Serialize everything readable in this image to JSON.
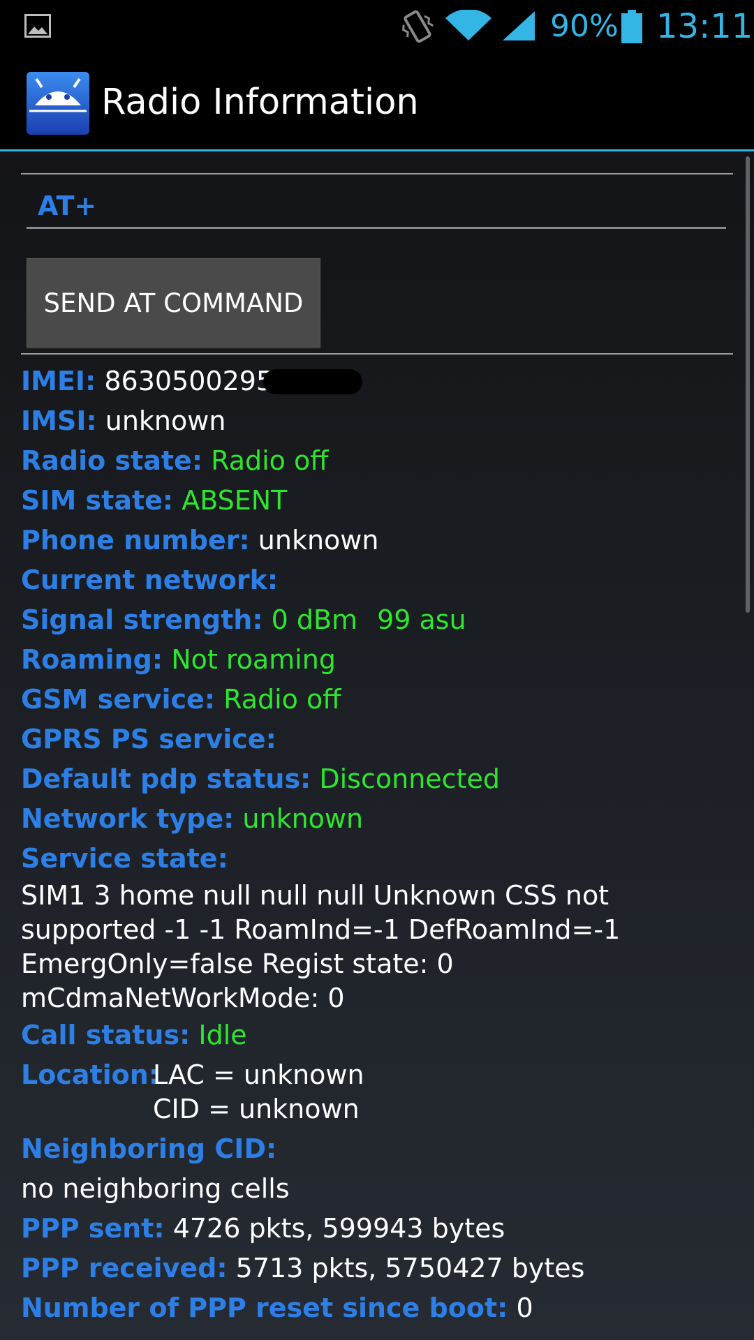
{
  "status_bar": {
    "battery_percent": "90%",
    "time": "13:11",
    "accent_color": "#33b5e5",
    "icons": [
      "image-notification-icon",
      "vibrate-icon",
      "wifi-icon",
      "cell-signal-icon",
      "battery-icon"
    ]
  },
  "action_bar": {
    "title": "Radio Information",
    "icon": "radio-info-app-icon"
  },
  "at_command": {
    "input_value": "AT+",
    "button_label": "SEND AT COMMAND"
  },
  "info": {
    "imei": {
      "label": "IMEI:",
      "value": "8630500295"
    },
    "imsi": {
      "label": "IMSI:",
      "value": "unknown"
    },
    "radio_state": {
      "label": "Radio state:",
      "value": "Radio off"
    },
    "sim_state": {
      "label": "SIM state:",
      "value": "ABSENT"
    },
    "phone_number": {
      "label": "Phone number:",
      "value": "unknown"
    },
    "current_network": {
      "label": "Current network:",
      "value": ""
    },
    "signal_strength": {
      "label": "Signal strength:",
      "dbm": "0 dBm",
      "asu": "99 asu"
    },
    "roaming": {
      "label": "Roaming:",
      "value": "Not roaming"
    },
    "gsm_service": {
      "label": "GSM service:",
      "value": "Radio off"
    },
    "gprs_service": {
      "label": "GPRS PS service:",
      "value": ""
    },
    "pdp_status": {
      "label": "Default pdp status:",
      "value": "Disconnected"
    },
    "network_type": {
      "label": "Network type:",
      "value": "unknown"
    },
    "service_state": {
      "label": "Service state:",
      "lines": [
        "SIM1 3 home null null null  Unknown CSS not",
        "supported -1 -1 RoamInd=-1 DefRoamInd=-1",
        "EmergOnly=false Regist state: 0",
        "mCdmaNetWorkMode: 0"
      ]
    },
    "call_status": {
      "label": "Call status:",
      "value": "Idle"
    },
    "location": {
      "label": "Location:",
      "lac": "LAC = unknown",
      "cid": "CID = unknown"
    },
    "neighboring_cid": {
      "label": "Neighboring CID:",
      "value": "no neighboring cells"
    },
    "ppp_sent": {
      "label": "PPP sent:",
      "value": "4726 pkts, 599943 bytes"
    },
    "ppp_received": {
      "label": "PPP received:",
      "value": "5713 pkts, 5750427 bytes"
    },
    "ppp_reset": {
      "label": "Number of PPP reset since boot:",
      "value": "0"
    }
  },
  "colors": {
    "label_blue": "#2d7fe6",
    "value_green": "#2ee62e",
    "value_white": "#ffffff"
  }
}
